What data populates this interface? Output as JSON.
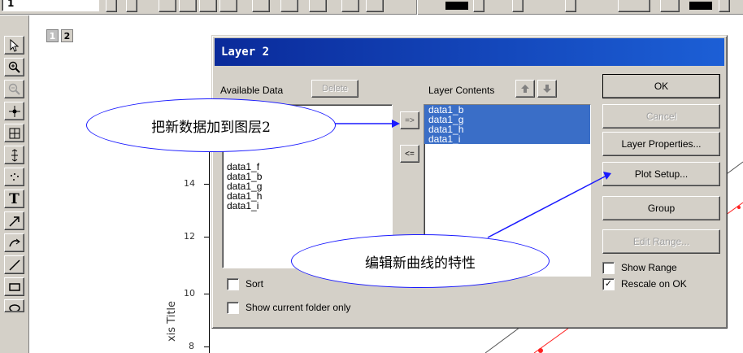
{
  "toolbar": {
    "left_field": "1"
  },
  "layer_tabs": [
    "1",
    "2"
  ],
  "dialog": {
    "title": "Layer 2",
    "available_label": "Available Data",
    "delete_label": "Delete",
    "contents_label": "Layer Contents",
    "available_items": [
      "data1_f",
      "data1_b",
      "data1_g",
      "data1_h",
      "data1_i"
    ],
    "contents_items": [
      "data1_b",
      "data1_g",
      "data1_h",
      "data1_i"
    ],
    "add_arrow": "=>",
    "remove_arrow": "<=",
    "ok_label": "OK",
    "cancel_label": "Cancel",
    "layer_props_label": "Layer Properties...",
    "plot_setup_label": "Plot Setup...",
    "group_label": "Group",
    "edit_range_label": "Edit Range...",
    "show_range_label": "Show Range",
    "rescale_label": "Rescale on OK",
    "sort_label": "Sort",
    "show_folder_label": "Show current folder only",
    "show_range_checked": false,
    "rescale_checked": true,
    "sort_checked": false,
    "show_folder_checked": false
  },
  "plot": {
    "y_ticks": [
      "14",
      "12",
      "10",
      "8"
    ],
    "y_axis_title": "xis Title"
  },
  "annotations": {
    "callout1": "把新数据加到图层2",
    "callout2": "编辑新曲线的特性"
  },
  "colors": {
    "dialog_title_bar": "#0a2a9a",
    "selection": "#3a6ec7",
    "callout_border": "#1a1aff",
    "curve": "#ff2020"
  }
}
